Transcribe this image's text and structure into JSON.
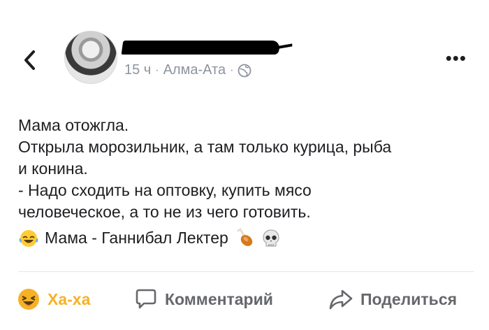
{
  "header": {
    "back_icon": "chevron-left-icon",
    "time": "15 ч",
    "separator": "·",
    "location": "Алма-Ата",
    "privacy_icon": "globe-icon",
    "more_icon": "more-horizontal-icon",
    "more_text": "•••"
  },
  "post": {
    "lines": [
      "Мама отожгла.",
      "Открыла морозильник, а там только курица, рыба",
      "и конина.",
      "- Надо сходить на оптовку, купить мясо",
      "человеческое, а то не из чего готовить."
    ],
    "emoji_line": {
      "lead_emoji": "laughing-tears-emoji",
      "text": "Мама - Ганнибал Лектер",
      "trail_emojis": [
        "poultry-leg-emoji",
        "skull-emoji"
      ]
    }
  },
  "actions": {
    "reaction_label": "Ха-ха",
    "comment_label": "Комментарий",
    "share_label": "Поделиться"
  },
  "colors": {
    "haha": "#f7b125",
    "muted": "#65676b",
    "meta": "#8d949e"
  }
}
